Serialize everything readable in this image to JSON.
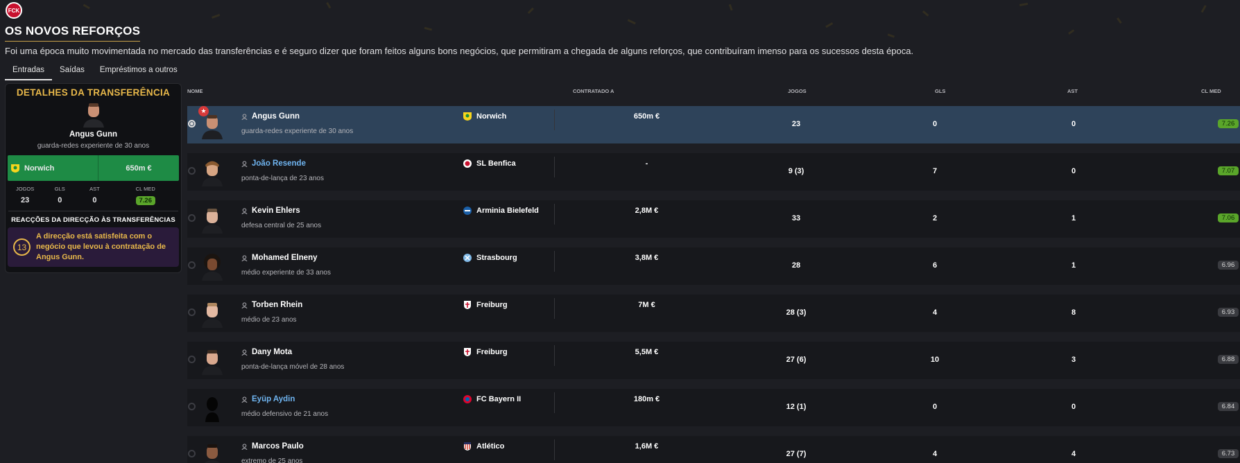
{
  "header": {
    "club_logo": "FCK",
    "title": "OS NOVOS REFORÇOS",
    "subtitle": "Foi uma época muito movimentada no mercado das transferências e é seguro dizer que foram feitos alguns bons negócios, que permitiram a chegada de alguns reforços, que contribuíram imenso para os sucessos desta época."
  },
  "tabs": [
    {
      "label": "Entradas",
      "active": true
    },
    {
      "label": "Saídas",
      "active": false
    },
    {
      "label": "Empréstimos a outros",
      "active": false
    }
  ],
  "details": {
    "heading": "DETALHES DA TRANSFERÊNCIA",
    "player_name": "Angus Gunn",
    "player_desc": "guarda-redes experiente de 30 anos",
    "club": "Norwich",
    "fee": "650m €",
    "stat_headers": [
      "JOGOS",
      "GLS",
      "AST",
      "CL MED"
    ],
    "stat_values": [
      "23",
      "0",
      "0",
      "7.26"
    ],
    "reactions_title": "REACÇÕES DA DIRECÇÃO ÀS TRANSFERÊNCIAS",
    "reaction_number": "13",
    "reaction_text": "A direcção está satisfeita com o negócio que levou à contratação de Angus Gunn."
  },
  "table": {
    "headers": {
      "name": "NOME",
      "signed_from": "CONTRATADO A",
      "apps": "JOGOS",
      "goals": "GLS",
      "assists": "AST",
      "rating": "CL MED"
    },
    "rows": [
      {
        "name": "Angus Gunn",
        "desc": "guarda-redes experiente de 30 anos",
        "club": "Norwich",
        "fee": "650m €",
        "apps": "23",
        "goals": "0",
        "assists": "0",
        "rating": "7.26"
      },
      {
        "name": "João Resende",
        "desc": "ponta-de-lança de 23 anos",
        "club": "SL Benfica",
        "fee": "-",
        "apps": "9 (3)",
        "goals": "7",
        "assists": "0",
        "rating": "7.07"
      },
      {
        "name": "Kevin Ehlers",
        "desc": "defesa central de 25 anos",
        "club": "Arminia Bielefeld",
        "fee": "2,8M €",
        "apps": "33",
        "goals": "2",
        "assists": "1",
        "rating": "7.06"
      },
      {
        "name": "Mohamed Elneny",
        "desc": "médio experiente de 33 anos",
        "club": "Strasbourg",
        "fee": "3,8M €",
        "apps": "28",
        "goals": "6",
        "assists": "1",
        "rating": "6.96"
      },
      {
        "name": "Torben Rhein",
        "desc": "médio de 23 anos",
        "club": "Freiburg",
        "fee": "7M €",
        "apps": "28 (3)",
        "goals": "4",
        "assists": "8",
        "rating": "6.93"
      },
      {
        "name": "Dany Mota",
        "desc": "ponta-de-lança móvel de 28 anos",
        "club": "Freiburg",
        "fee": "5,5M €",
        "apps": "27 (6)",
        "goals": "10",
        "assists": "3",
        "rating": "6.88"
      },
      {
        "name": "Eyüp Aydin",
        "desc": "médio defensivo de 21 anos",
        "club": "FC Bayern II",
        "fee": "180m €",
        "apps": "12 (1)",
        "goals": "0",
        "assists": "0",
        "rating": "6.84"
      },
      {
        "name": "Marcos Paulo",
        "desc": "extremo de 25 anos",
        "club": "Atlético",
        "fee": "1,6M €",
        "apps": "27 (7)",
        "goals": "4",
        "assists": "4",
        "rating": "6.73"
      }
    ]
  },
  "colors": {
    "accent_gold": "#e8b84a",
    "selected_row": "#2e435a",
    "good_rating": "#5aa52a",
    "deal_green": "#1e8b45"
  }
}
